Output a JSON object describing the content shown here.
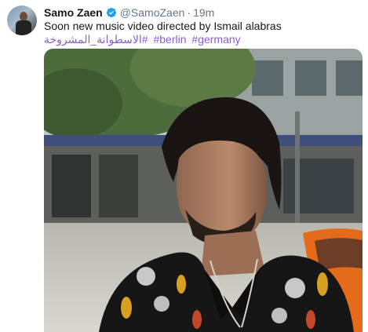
{
  "tweet": {
    "author_name": "Samo Zaen",
    "handle": "@SamoZaen",
    "separator": "·",
    "time": "19m",
    "text": "Soon new music video directed by Ismail alabras",
    "hashtags": [
      "#الاسطوانة_المشروخة",
      "#berlin",
      "#germany"
    ],
    "verified_icon": "verified-badge-icon",
    "accent_color": "#1da1f2",
    "hashtag_color": "#8a5fc7"
  }
}
